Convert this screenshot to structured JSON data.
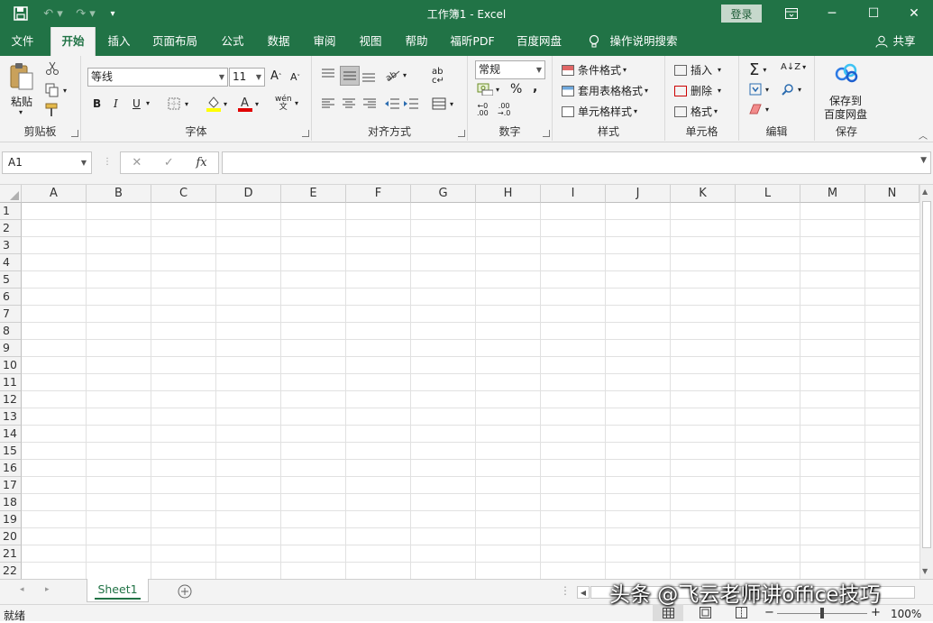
{
  "titlebar": {
    "title": "工作簿1  -  Excel",
    "login": "登录"
  },
  "tabs": [
    "文件",
    "开始",
    "插入",
    "页面布局",
    "公式",
    "数据",
    "审阅",
    "视图",
    "帮助",
    "福昕PDF",
    "百度网盘"
  ],
  "tell_me": "操作说明搜索",
  "share": "共享",
  "ribbon": {
    "clipboard": {
      "paste": "粘贴",
      "label": "剪贴板"
    },
    "font": {
      "name": "等线",
      "size": "11",
      "label": "字体",
      "bold": "B",
      "italic": "I",
      "underline": "U",
      "phonetic": "wén"
    },
    "alignment": {
      "label": "对齐方式"
    },
    "number": {
      "format": "常规",
      "label": "数字",
      "percent": "%",
      "comma": ","
    },
    "styles": {
      "conditional": "条件格式",
      "table": "套用表格格式",
      "cell": "单元格样式",
      "label": "样式"
    },
    "cells": {
      "insert": "插入",
      "delete": "删除",
      "format": "格式",
      "label": "单元格"
    },
    "editing": {
      "label": "编辑"
    },
    "save": {
      "line1": "保存到",
      "line2": "百度网盘",
      "label": "保存"
    }
  },
  "formula_bar": {
    "name_box": "A1",
    "fx": "fx",
    "value": ""
  },
  "columns": [
    "A",
    "B",
    "C",
    "D",
    "E",
    "F",
    "G",
    "H",
    "I",
    "J",
    "K",
    "L",
    "M",
    "N"
  ],
  "rows": [
    "1",
    "2",
    "3",
    "4",
    "5",
    "6",
    "7",
    "8",
    "9",
    "10",
    "11",
    "12",
    "13",
    "14",
    "15",
    "16",
    "17",
    "18",
    "19",
    "20",
    "21",
    "22"
  ],
  "sheets": [
    "Sheet1"
  ],
  "status": {
    "text": "就绪",
    "zoom": "100%"
  },
  "watermark": "头条 @飞云老师讲office技巧",
  "colors": {
    "brand": "#217346",
    "ribbon_bg": "#f3f3f3"
  }
}
